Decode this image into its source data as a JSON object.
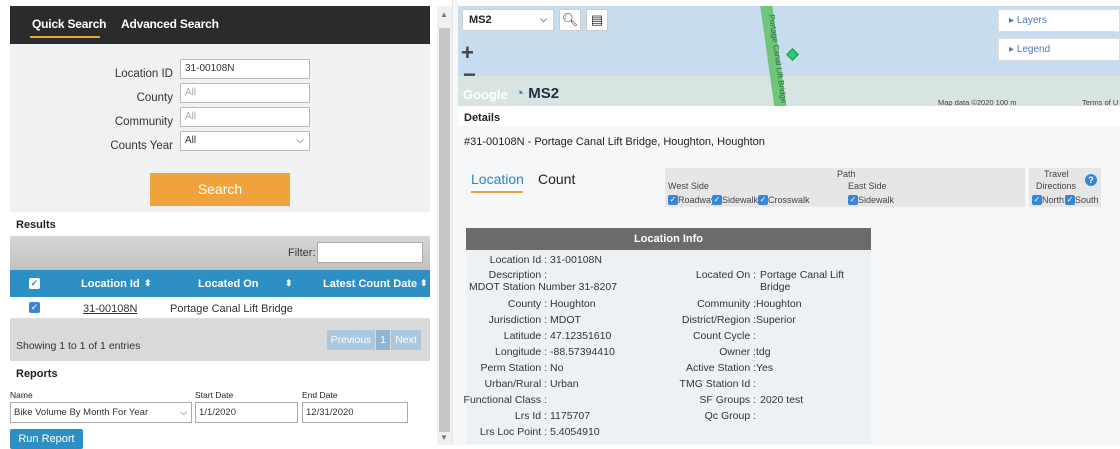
{
  "search": {
    "tabs": [
      "Quick Search",
      "Advanced Search"
    ],
    "fields": [
      {
        "label": "Location ID",
        "value": "31-00108N",
        "placeholder": ""
      },
      {
        "label": "County",
        "value": "",
        "placeholder": "All"
      },
      {
        "label": "Community",
        "value": "",
        "placeholder": "All"
      },
      {
        "label": "Counts Year",
        "value": "All",
        "placeholder": ""
      }
    ],
    "search_button": "Search"
  },
  "results": {
    "title": "Results",
    "filter_label": "Filter:",
    "columns": [
      "✓",
      "Location Id",
      "Located On",
      "Latest Count Date"
    ],
    "rows": [
      {
        "location_id": "31-00108N",
        "located_on": "Portage Canal Lift Bridge",
        "latest_count_date": ""
      }
    ],
    "showing": "Showing 1 to 1 of 1 entries",
    "pagination": {
      "previous": "Previous",
      "page": "1",
      "next": "Next"
    }
  },
  "reports": {
    "title": "Reports",
    "labels": {
      "name": "Name",
      "start": "Start Date",
      "end": "End Date"
    },
    "name_value": "Bike Volume By Month For Year",
    "start_value": "1/1/2020",
    "end_value": "12/31/2020",
    "run_button": "Run Report"
  },
  "map": {
    "layer_select": "MS2",
    "layers_label": "Layers",
    "legend_label": "Legend",
    "google": "Google",
    "logo": "MS2",
    "attribution": "Map data ©2020   100 m",
    "terms": "Terms of U",
    "road_label": "Portage Canal Lift Bridge"
  },
  "details": {
    "title": "Details",
    "heading": "#31-00108N - Portage Canal Lift Bridge, Houghton, Houghton",
    "tabs": [
      "Location",
      "Count"
    ],
    "path_label": "Path",
    "west_side": "West Side",
    "east_side": "East Side",
    "west_items": [
      "Roadway",
      "Sidewalk",
      "Crosswalk"
    ],
    "east_items": [
      "Sidewalk"
    ],
    "travel_label": "Travel",
    "directions_label": "Directions",
    "directions": [
      "North",
      "South"
    ],
    "help_icon": "?"
  },
  "location_info": {
    "title": "Location Info",
    "left": [
      {
        "label": "Location Id :",
        "value": "31-00108N"
      },
      {
        "label": "Description :",
        "value": ""
      },
      {
        "label": "",
        "value": "MDOT Station Number 31-8207"
      },
      {
        "label": "County :",
        "value": "Houghton"
      },
      {
        "label": "Jurisdiction :",
        "value": "MDOT"
      },
      {
        "label": "Latitude :",
        "value": "47.12351610"
      },
      {
        "label": "Longitude :",
        "value": "-88.57394410"
      },
      {
        "label": "Perm Station :",
        "value": "No"
      },
      {
        "label": "Urban/Rural :",
        "value": "Urban"
      },
      {
        "label": "Functional Class :",
        "value": ""
      },
      {
        "label": "Lrs Id :",
        "value": "1175707"
      },
      {
        "label": "Lrs Loc Point :",
        "value": "5.4054910"
      }
    ],
    "right": [
      {
        "label": "Located On :",
        "value": "Portage Canal Lift"
      },
      {
        "label": "",
        "value": "Bridge"
      },
      {
        "label": "Community :",
        "value": "Houghton"
      },
      {
        "label": "District/Region :",
        "value": "Superior"
      },
      {
        "label": "Count Cycle :",
        "value": ""
      },
      {
        "label": "Owner :",
        "value": "tdg"
      },
      {
        "label": "Active Station :",
        "value": "Yes"
      },
      {
        "label": "TMG Station Id :",
        "value": ""
      },
      {
        "label": "SF Groups :",
        "value": "2020 test"
      },
      {
        "label": "Qc Group :",
        "value": ""
      }
    ]
  },
  "colors": {
    "accent": "#e8a33c",
    "table_header": "#2e8fc4",
    "dark_bar": "#2b2b2b"
  }
}
